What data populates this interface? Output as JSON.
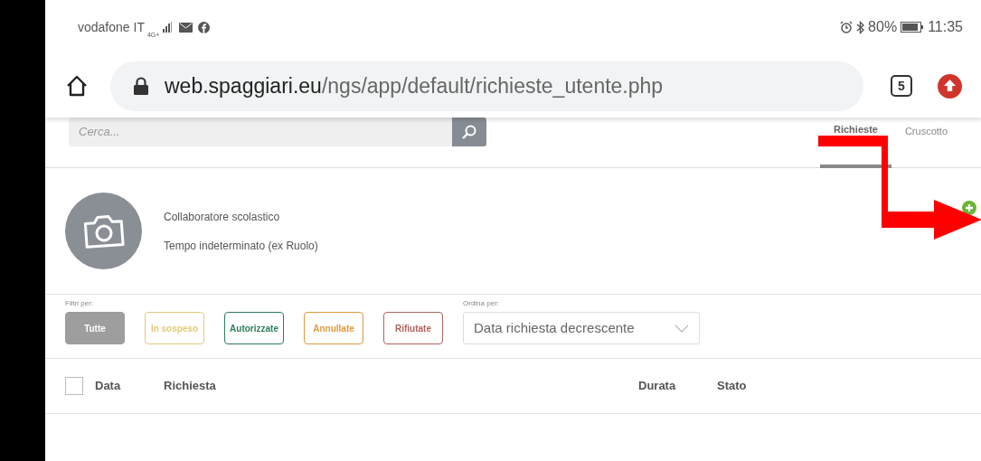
{
  "status_bar": {
    "carrier": "vodafone IT",
    "network": "4G+",
    "battery": "80%",
    "time": "11:35"
  },
  "browser": {
    "url_host": "web.spaggiari.eu",
    "url_path": "/ngs/app/default/richieste_utente.php",
    "tab_count": "5"
  },
  "search": {
    "placeholder": "Cerca..."
  },
  "tabs": [
    {
      "label": "Richieste",
      "selected": true
    },
    {
      "label": "Cruscotto",
      "selected": false
    }
  ],
  "profile": {
    "role": "Collaboratore scolastico",
    "contract": "Tempo indeterminato (ex Ruolo)"
  },
  "filters": {
    "label": "Filtri per:",
    "items": [
      {
        "label": "Tutte",
        "selected": true,
        "color": "#9e9e9e"
      },
      {
        "label": "In sospeso",
        "selected": false,
        "color": "#e5c97a"
      },
      {
        "label": "Autorizzate",
        "selected": false,
        "color": "#2e7d5b"
      },
      {
        "label": "Annullate",
        "selected": false,
        "color": "#e09a3c"
      },
      {
        "label": "Rifiutate",
        "selected": false,
        "color": "#b0635e"
      }
    ]
  },
  "sort": {
    "label": "Ordina per:",
    "value": "Data richiesta decrescente"
  },
  "table": {
    "select_all_checked": false,
    "columns": [
      "Data",
      "Richiesta",
      "Durata",
      "Stato"
    ]
  }
}
